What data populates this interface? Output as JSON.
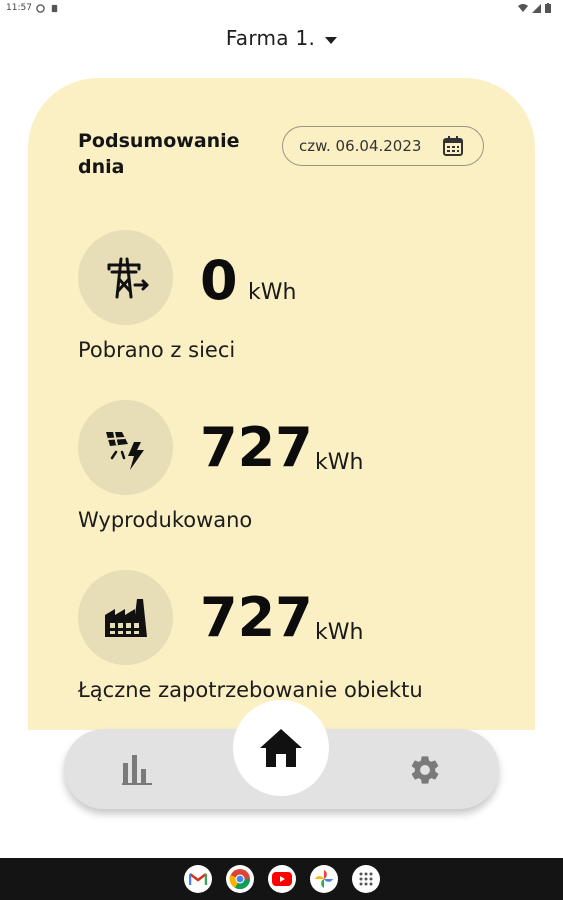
{
  "status_bar": {
    "time": "11:57"
  },
  "header": {
    "farm_label": "Farma 1."
  },
  "summary": {
    "title_line1": "Podsumowanie",
    "title_line2": "dnia",
    "date": "czw. 06.04.2023"
  },
  "metrics": [
    {
      "icon": "power-tower-icon",
      "value": "0",
      "unit": "kWh",
      "label": "Pobrano z sieci"
    },
    {
      "icon": "solar-panel-bolt-icon",
      "value": "727",
      "unit": "kWh",
      "label": "Wyprodukowano"
    },
    {
      "icon": "factory-icon",
      "value": "727",
      "unit": "kWh",
      "label": "Łączne zapotrzebowanie obiektu"
    }
  ],
  "nav": {
    "items": [
      {
        "icon": "bar-chart-icon"
      },
      {
        "icon": "home-icon",
        "active": true
      },
      {
        "icon": "gear-icon"
      }
    ]
  },
  "system_apps": [
    "gmail-icon",
    "chrome-icon",
    "youtube-icon",
    "photos-icon",
    "app-drawer-icon"
  ],
  "colors": {
    "card": "#fbf0c4",
    "icon_circle": "#e7ddb6",
    "nav": "#e2e2e2"
  }
}
